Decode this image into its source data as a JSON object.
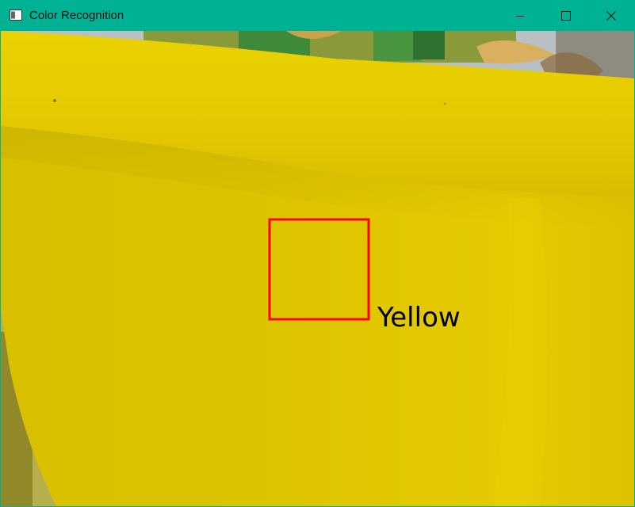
{
  "window": {
    "title": "Color Recognition",
    "icon": "app-window-icon",
    "controls": {
      "minimize_icon": "minimize-icon",
      "maximize_icon": "maximize-icon",
      "close_icon": "close-icon"
    }
  },
  "detection": {
    "label": "Yellow",
    "box_color": "#ff0000",
    "label_color": "#000000"
  },
  "colors": {
    "titlebar": "#00b294",
    "pot_yellow": "#e2c800",
    "pot_rim_yellow": "#dcc400"
  }
}
